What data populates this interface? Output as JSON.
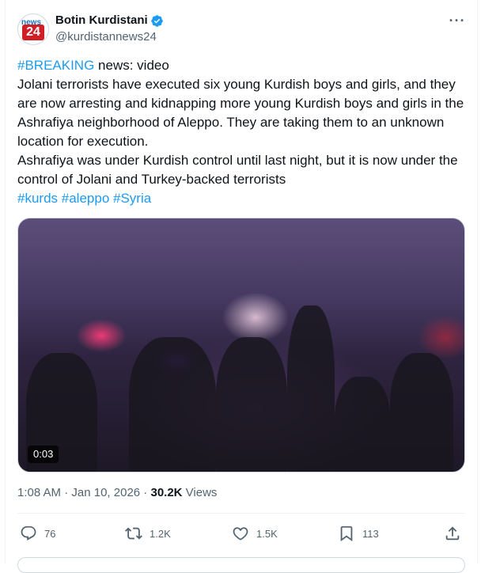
{
  "author": {
    "name": "Botin Kurdistani",
    "handle": "@kurdistannews24",
    "avatar_text_top": "news",
    "avatar_text_bottom": "24",
    "verified": true
  },
  "tweet": {
    "line1_tag": "#BREAKING",
    "line1_rest": " news: video",
    "paragraph1": "Jolani terrorists have executed six young Kurdish boys and girls, and they are now arresting and kidnapping more young Kurdish boys and girls in the Ashrafiya neighborhood of Aleppo. They are taking them to an unknown location for execution.",
    "paragraph2": "Ashrafiya was under Kurdish control until last night, but it is now under the control of Jolani and Turkey-backed terrorists",
    "hashtags": [
      "#kurds",
      "#aleppo",
      "#Syria"
    ]
  },
  "media": {
    "duration": "0:03"
  },
  "meta": {
    "time": "1:08 AM",
    "sep1": " · ",
    "date": "Jan 10, 2026",
    "sep2": " · ",
    "views_count": "30.2K",
    "views_label": " Views"
  },
  "actions": {
    "replies": "76",
    "reposts": "1.2K",
    "likes": "1.5K",
    "bookmarks": "113"
  },
  "colors": {
    "link": "#1d9bf0",
    "secondary_text": "#536471",
    "verified_badge": "#1d9bf0"
  }
}
